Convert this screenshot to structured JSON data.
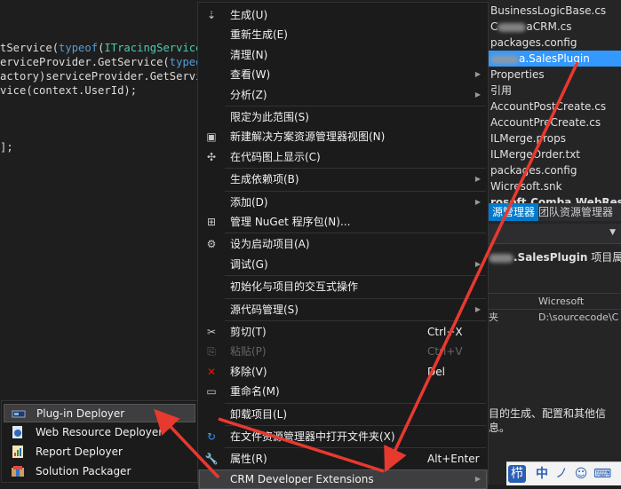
{
  "editor": {
    "lines": [
      {
        "parts": [
          {
            "t": "tService(",
            "c": ""
          },
          {
            "t": "typeof",
            "c": "kw"
          },
          {
            "t": "(",
            "c": ""
          },
          {
            "t": "ITracingService",
            "c": "ty"
          },
          {
            "t": ")",
            "c": ""
          }
        ]
      },
      {
        "parts": [
          {
            "t": "erviceProvider.GetService(",
            "c": ""
          },
          {
            "t": "typeof",
            "c": "kw"
          }
        ]
      },
      {
        "parts": [
          {
            "t": "actory)serviceProvider.GetServic",
            "c": ""
          }
        ]
      },
      {
        "parts": [
          {
            "t": "vice(context.UserId);",
            "c": ""
          }
        ]
      },
      {
        "parts": [
          {
            "t": "",
            "c": ""
          }
        ]
      },
      {
        "parts": [
          {
            "t": "",
            "c": ""
          }
        ]
      },
      {
        "parts": [
          {
            "t": "",
            "c": ""
          }
        ]
      },
      {
        "parts": [
          {
            "t": "];",
            "c": ""
          }
        ]
      }
    ]
  },
  "solution_explorer": {
    "items": [
      {
        "label": "BusinessLogicBase.cs",
        "selected": false
      },
      {
        "prefix": "C",
        "label": "aCRM.cs",
        "blur": true,
        "selected": false
      },
      {
        "label": "packages.config",
        "selected": false
      },
      {
        "prefix": "",
        "label": "a.SalesPlugin",
        "blur": true,
        "selected": true
      },
      {
        "label": "Properties",
        "selected": false
      },
      {
        "label": "引用",
        "selected": false
      },
      {
        "label": "AccountPostCreate.cs",
        "selected": false
      },
      {
        "label": "AccountPreCreate.cs",
        "selected": false
      },
      {
        "label": "ILMerge.props",
        "selected": false
      },
      {
        "label": "ILMergeOrder.txt",
        "selected": false
      },
      {
        "label": "packages.config",
        "selected": false
      },
      {
        "label": "Wicresoft.snk",
        "selected": false
      },
      {
        "label": "rosoft.Comba.WebResour",
        "selected": false
      }
    ],
    "tabs": [
      "源管理器",
      "团队资源管理器"
    ],
    "props_title_prefix": "",
    "props_title_name": ".SalesPlugin",
    "props_title_suffix": "项目属",
    "props_rows": [
      {
        "key": "",
        "value": "Wicresoft"
      },
      {
        "key": "夹",
        "value": "D:\\sourcecode\\C"
      }
    ],
    "description": "目的生成、配置和其他信息。"
  },
  "context_menu": {
    "items": [
      {
        "id": "build",
        "icon": "build-icon",
        "glyph": "⇣",
        "label": "生成(U)"
      },
      {
        "id": "rebuild",
        "label": "重新生成(E)"
      },
      {
        "id": "clean",
        "label": "清理(N)"
      },
      {
        "id": "view",
        "label": "查看(W)",
        "submenu": true
      },
      {
        "id": "analyze",
        "label": "分析(Z)",
        "submenu": true
      },
      {
        "sep": true
      },
      {
        "id": "scope",
        "label": "限定为此范围(S)"
      },
      {
        "id": "new-view",
        "icon": "new-view-icon",
        "glyph": "▣",
        "label": "新建解决方案资源管理器视图(N)"
      },
      {
        "id": "code-map",
        "icon": "code-map-icon",
        "glyph": "✣",
        "label": "在代码图上显示(C)"
      },
      {
        "sep": true
      },
      {
        "id": "build-deps",
        "label": "生成依赖项(B)",
        "submenu": true
      },
      {
        "sep": true
      },
      {
        "id": "add",
        "label": "添加(D)",
        "submenu": true
      },
      {
        "id": "nuget",
        "icon": "nuget-icon",
        "glyph": "⊞",
        "label": "管理 NuGet 程序包(N)..."
      },
      {
        "sep": true
      },
      {
        "id": "startup",
        "icon": "gear-icon",
        "glyph": "⚙",
        "label": "设为启动项目(A)"
      },
      {
        "id": "debug",
        "label": "调试(G)",
        "submenu": true
      },
      {
        "sep": true
      },
      {
        "id": "interactive",
        "label": "初始化与项目的交互式操作"
      },
      {
        "sep": true
      },
      {
        "id": "source-control",
        "label": "源代码管理(S)",
        "submenu": true
      },
      {
        "sep": true
      },
      {
        "id": "cut",
        "icon": "scissors-icon",
        "glyph": "✂",
        "label": "剪切(T)",
        "shortcut": "Ctrl+X"
      },
      {
        "id": "paste",
        "icon": "paste-icon",
        "glyph": "⎘",
        "label": "粘贴(P)",
        "shortcut": "Ctrl+V",
        "disabled": true
      },
      {
        "id": "remove",
        "icon": "remove-icon",
        "glyph": "✕",
        "label": "移除(V)",
        "shortcut": "Del",
        "color": "#e51400"
      },
      {
        "id": "rename",
        "icon": "rename-icon",
        "glyph": "▭",
        "label": "重命名(M)"
      },
      {
        "sep": true
      },
      {
        "id": "unload",
        "label": "卸载项目(L)"
      },
      {
        "sep": true
      },
      {
        "id": "open-folder",
        "icon": "refresh-icon",
        "glyph": "↻",
        "label": "在文件资源管理器中打开文件夹(X)",
        "color": "#3399ff"
      },
      {
        "sep": true
      },
      {
        "id": "properties",
        "icon": "wrench-icon",
        "glyph": "🔧",
        "label": "属性(R)",
        "shortcut": "Alt+Enter"
      },
      {
        "id": "crm-dev",
        "label": "CRM Developer Extensions",
        "submenu": true,
        "hover": true
      }
    ]
  },
  "submenu": {
    "items": [
      {
        "id": "plugin-deployer",
        "icon": "plugin-icon",
        "label": "Plug-in Deployer",
        "hover": true
      },
      {
        "id": "webresource-deployer",
        "icon": "web-resource-icon",
        "label": "Web Resource Deployer"
      },
      {
        "id": "report-deployer",
        "icon": "report-icon",
        "label": "Report Deployer"
      },
      {
        "id": "solution-packager",
        "icon": "package-icon",
        "label": "Solution Packager"
      }
    ]
  },
  "taskbar": {
    "ime": [
      "中",
      "ノ",
      "☺",
      "⌨"
    ]
  },
  "colors": {
    "menu_bg": "#1b1b1c",
    "hover": "#3e3e40",
    "selection": "#3399ff",
    "arrow": "#e8392f"
  }
}
